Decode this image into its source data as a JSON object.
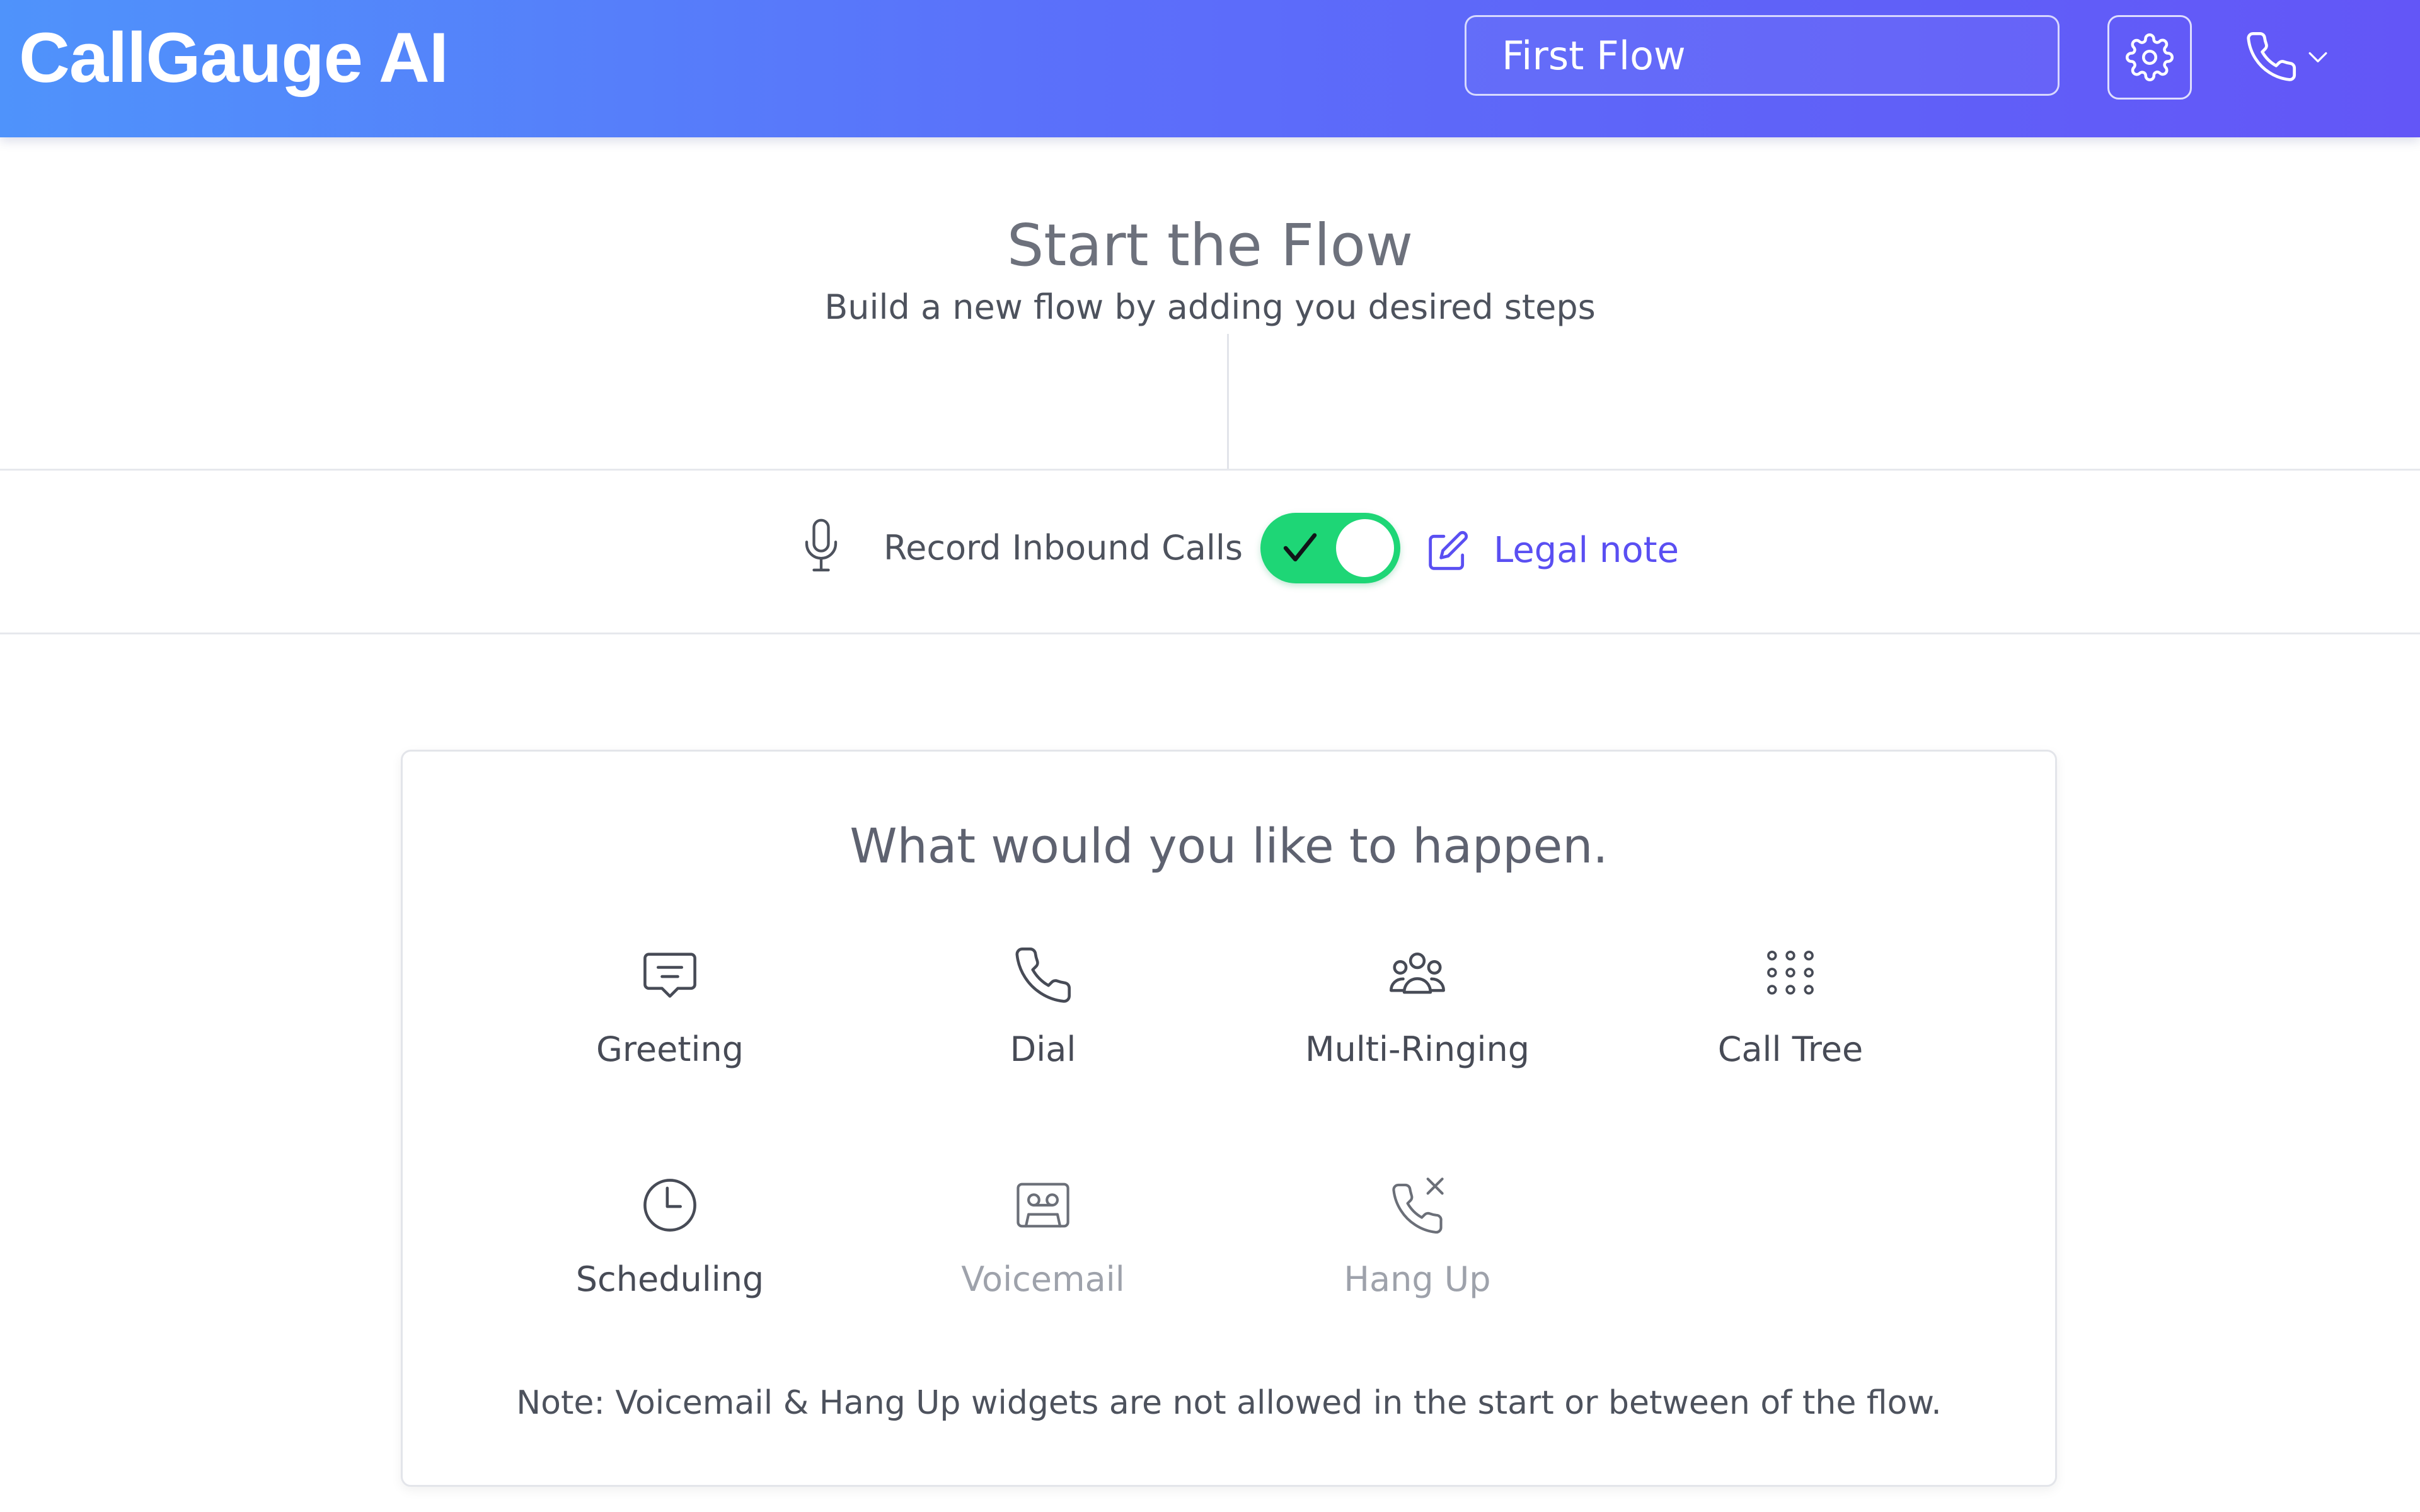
{
  "header": {
    "brand": "CallGauge AI",
    "flow_name": "First Flow",
    "settings_icon": "gear-icon",
    "phone_icon": "phone-icon",
    "caret_icon": "chevron-down-icon"
  },
  "start": {
    "title": "Start the Flow",
    "subtitle": "Build a new flow by adding you desired steps"
  },
  "record": {
    "label": "Record Inbound Calls",
    "enabled": true,
    "legal_note": "Legal note"
  },
  "options": {
    "title": "What would you like to happen.",
    "items": [
      {
        "label": "Greeting",
        "icon": "message-icon",
        "enabled": true
      },
      {
        "label": "Dial",
        "icon": "phone-icon",
        "enabled": true
      },
      {
        "label": "Multi-Ringing",
        "icon": "users-icon",
        "enabled": true
      },
      {
        "label": "Call Tree",
        "icon": "keypad-icon",
        "enabled": true
      },
      {
        "label": "Scheduling",
        "icon": "clock-icon",
        "enabled": true
      },
      {
        "label": "Voicemail",
        "icon": "voicemail-icon",
        "enabled": false
      },
      {
        "label": "Hang Up",
        "icon": "phone-hangup-icon",
        "enabled": false
      }
    ],
    "note": "Note: Voicemail & Hang Up widgets are not allowed in the start or between of the flow."
  },
  "colors": {
    "header_start": "#4f93fb",
    "header_end": "#6356f7",
    "toggle_on": "#1ed676",
    "link": "#5a4ff2"
  }
}
